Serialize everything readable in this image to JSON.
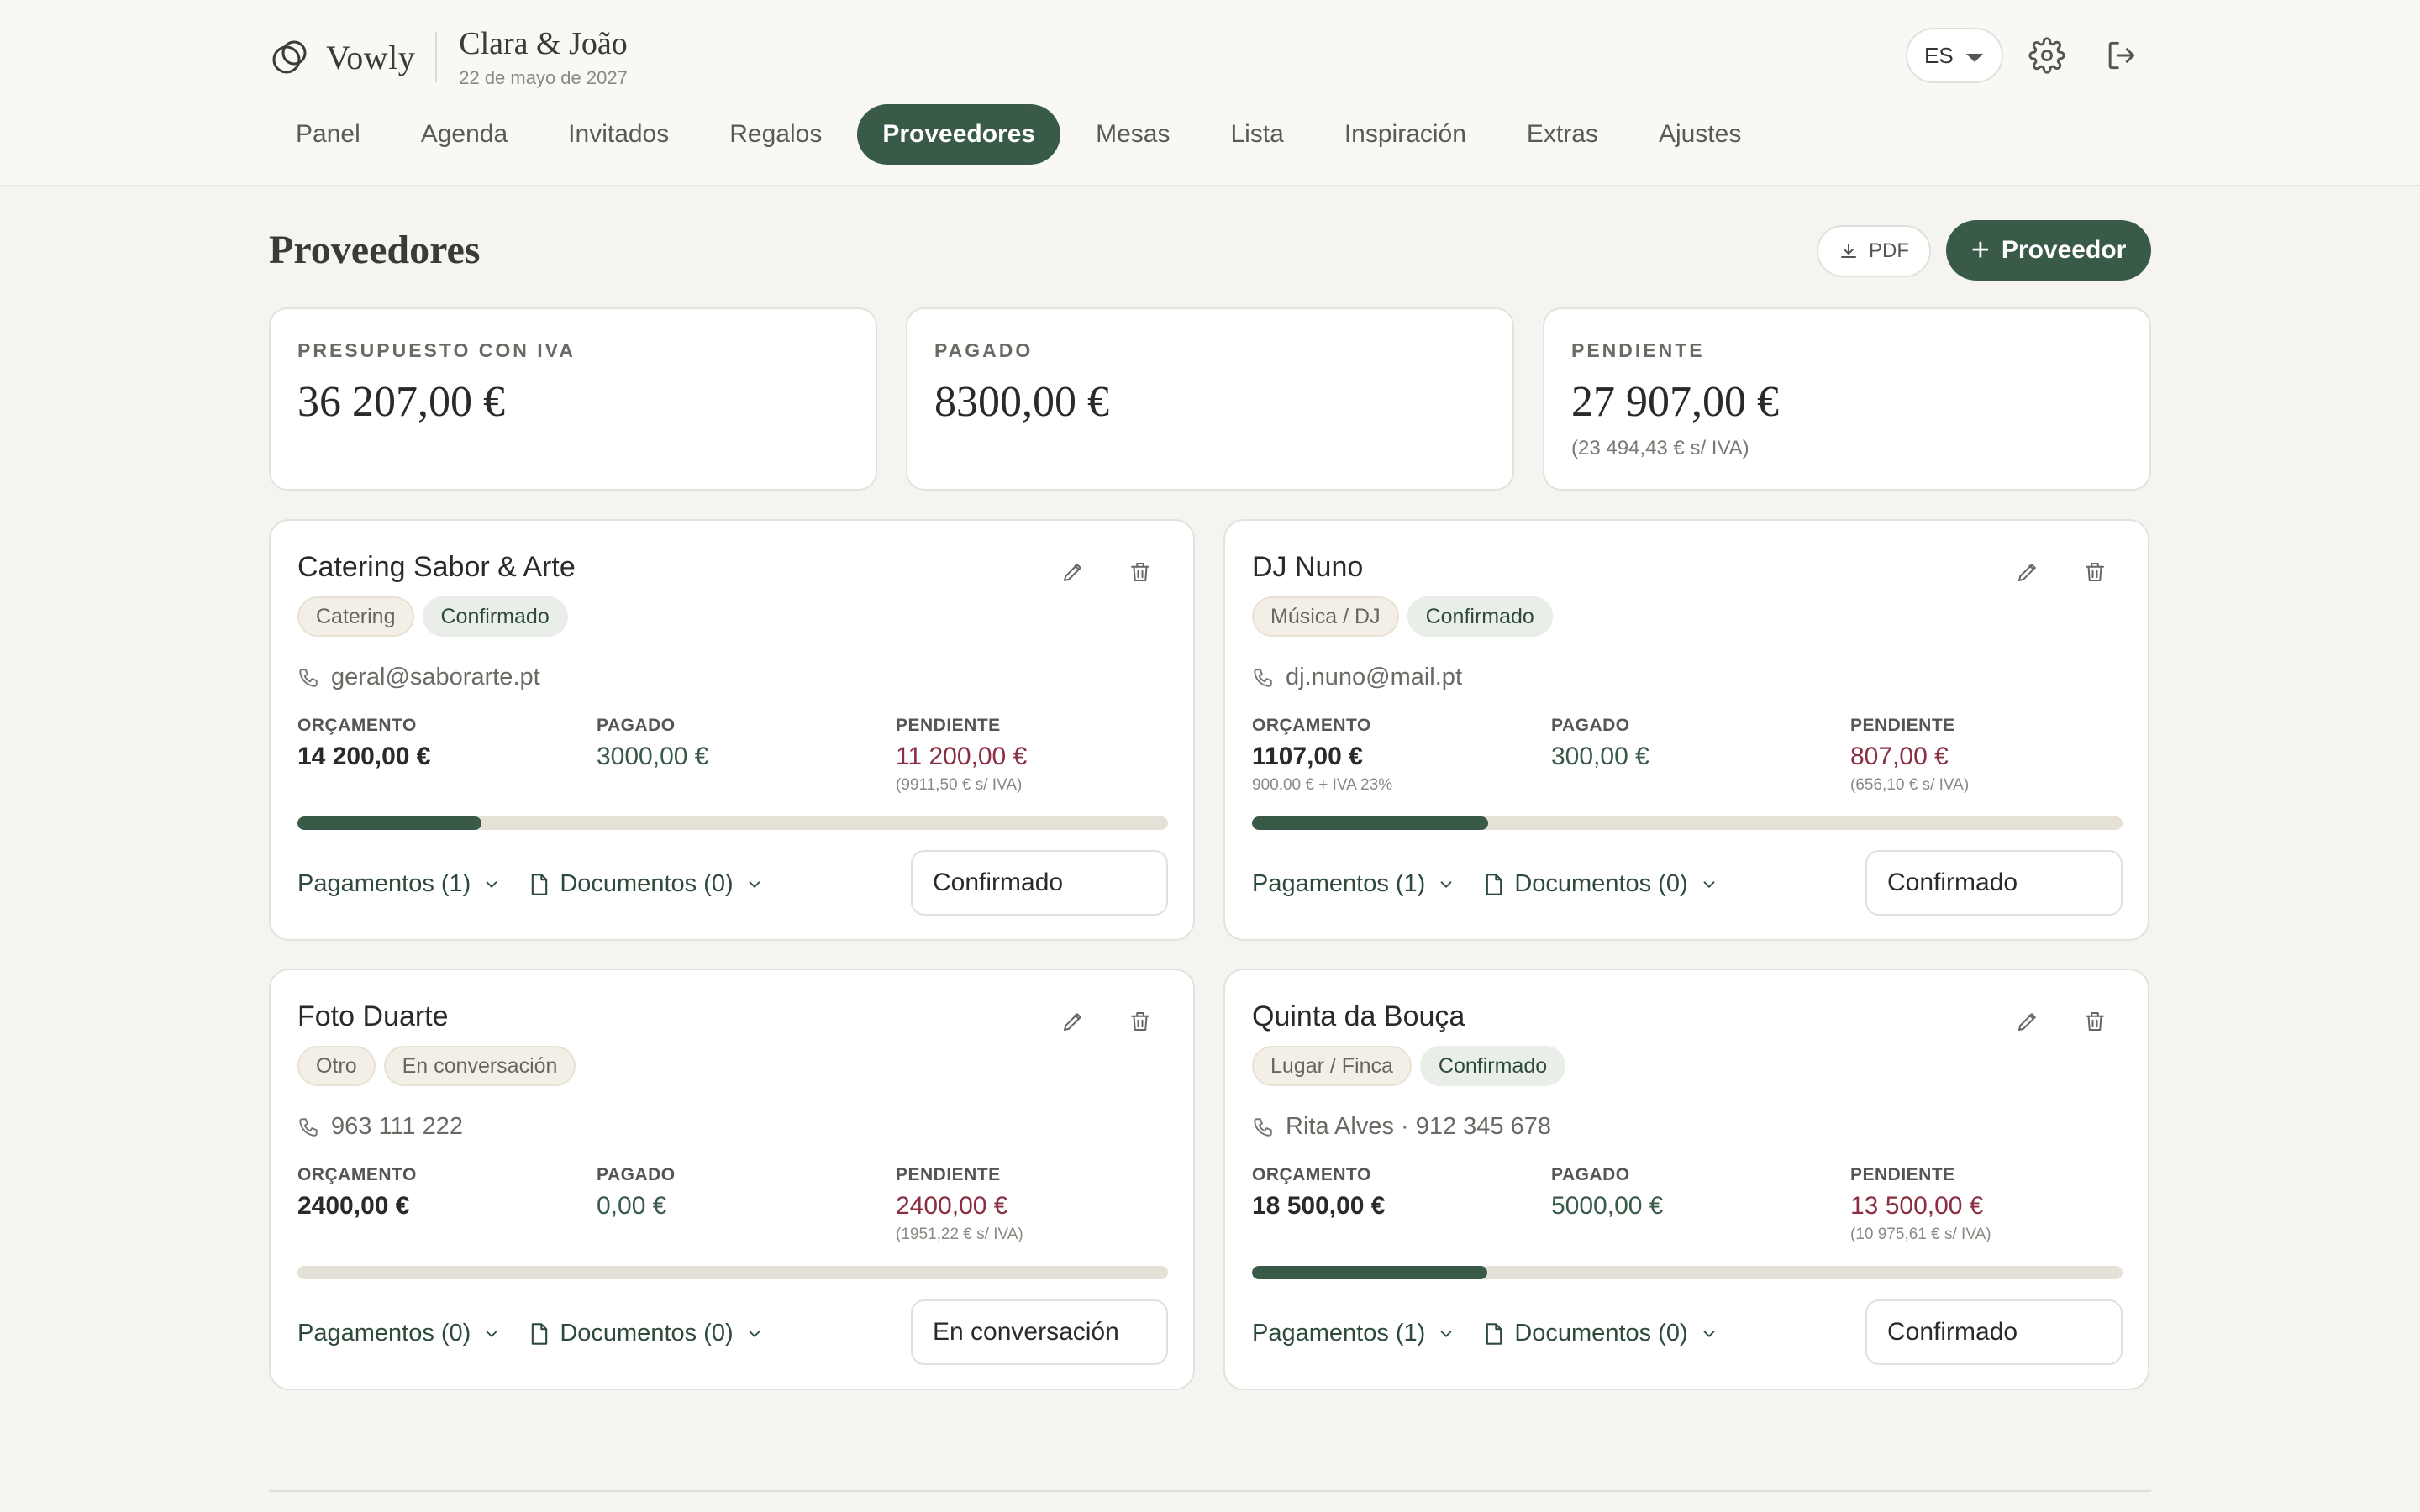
{
  "header": {
    "brand": "Vowly",
    "couple_name": "Clara & João",
    "wedding_date": "22 de mayo de 2027",
    "language": "ES"
  },
  "nav": [
    {
      "label": "Panel",
      "active": false
    },
    {
      "label": "Agenda",
      "active": false
    },
    {
      "label": "Invitados",
      "active": false
    },
    {
      "label": "Regalos",
      "active": false
    },
    {
      "label": "Proveedores",
      "active": true
    },
    {
      "label": "Mesas",
      "active": false
    },
    {
      "label": "Lista",
      "active": false
    },
    {
      "label": "Inspiración",
      "active": false
    },
    {
      "label": "Extras",
      "active": false
    },
    {
      "label": "Ajustes",
      "active": false
    }
  ],
  "page": {
    "title": "Proveedores",
    "pdf_label": "PDF",
    "add_label": "Proveedor"
  },
  "summary": [
    {
      "label": "PRESUPUESTO CON IVA",
      "value": "36 207,00 €",
      "sub": ""
    },
    {
      "label": "PAGADO",
      "value": "8300,00 €",
      "sub": ""
    },
    {
      "label": "PENDIENTE",
      "value": "27 907,00 €",
      "sub": "(23 494,43 € s/ IVA)"
    }
  ],
  "labels": {
    "budget": "ORÇAMENTO",
    "paid": "PAGADO",
    "pending": "PENDIENTE"
  },
  "vendors": [
    {
      "name": "Catering Sabor & Arte",
      "category": "Catering",
      "status": "Confirmado",
      "contact": "geral@saborarte.pt",
      "budget": "14 200,00 €",
      "budget_sub": "",
      "paid": "3000,00 €",
      "pending": "11 200,00 €",
      "pending_sub": "(9911,50 € s/ IVA)",
      "progress": 0.211,
      "payments": "Pagamentos (1)",
      "documents": "Documentos (0)",
      "status_select": "Confirmado"
    },
    {
      "name": "DJ Nuno",
      "category": "Música / DJ",
      "status": "Confirmado",
      "contact": "dj.nuno@mail.pt",
      "budget": "1107,00 €",
      "budget_sub": "900,00 € + IVA 23%",
      "paid": "300,00 €",
      "pending": "807,00 €",
      "pending_sub": "(656,10 € s/ IVA)",
      "progress": 0.271,
      "payments": "Pagamentos (1)",
      "documents": "Documentos (0)",
      "status_select": "Confirmado"
    },
    {
      "name": "Foto Duarte",
      "category": "Otro",
      "status": "En conversación",
      "contact": "963 111 222",
      "budget": "2400,00 €",
      "budget_sub": "",
      "paid": "0,00 €",
      "pending": "2400,00 €",
      "pending_sub": "(1951,22 € s/ IVA)",
      "progress": 0.0,
      "payments": "Pagamentos (0)",
      "documents": "Documentos (0)",
      "status_select": "En conversación"
    },
    {
      "name": "Quinta da Bouça",
      "category": "Lugar / Finca",
      "status": "Confirmado",
      "contact": "Rita Alves · 912 345 678",
      "budget": "18 500,00 €",
      "budget_sub": "",
      "paid": "5000,00 €",
      "pending": "13 500,00 €",
      "pending_sub": "(10 975,61 € s/ IVA)",
      "progress": 0.27,
      "payments": "Pagamentos (1)",
      "documents": "Documentos (0)",
      "status_select": "Confirmado"
    }
  ],
  "icons": {
    "logo": "interlocking-rings-icon",
    "settings": "gear-icon",
    "logout": "logout-icon",
    "download": "download-icon",
    "edit": "pencil-icon",
    "delete": "trash-icon",
    "contact": "phone-icon",
    "document": "document-icon",
    "chevron": "chevron-down-icon"
  },
  "colors": {
    "accent": "#3a5a48",
    "pending": "#8a2f42",
    "background": "#f5f4f0"
  }
}
